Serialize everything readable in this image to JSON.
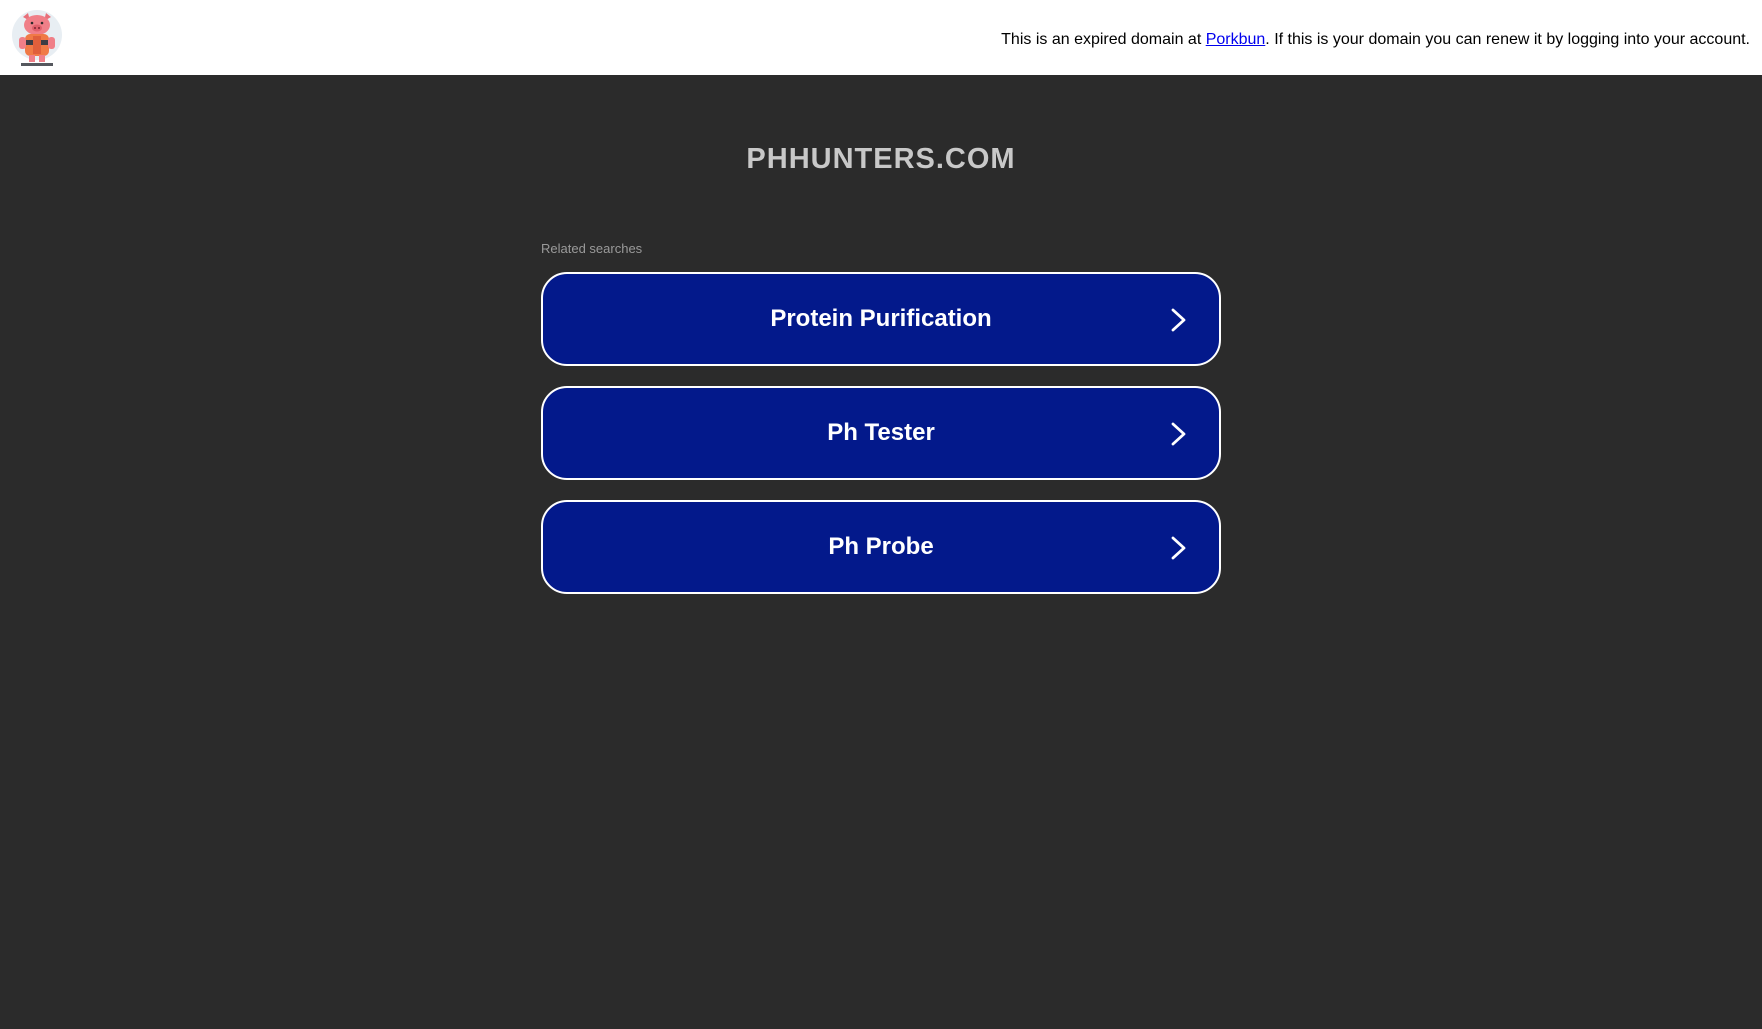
{
  "header": {
    "logo_icon": "porkbun-pig-logo-icon",
    "notice_prefix": "This is an expired domain at ",
    "notice_link": "Porkbun",
    "notice_suffix": ". If this is your domain you can renew it by logging into your account."
  },
  "main": {
    "domain_title": "PHHUNTERS.COM",
    "related_label": "Related searches",
    "searches": [
      {
        "label": "Protein Purification",
        "icon": "chevron-right-icon"
      },
      {
        "label": "Ph Tester",
        "icon": "chevron-right-icon"
      },
      {
        "label": "Ph Probe",
        "icon": "chevron-right-icon"
      }
    ]
  },
  "colors": {
    "page_background": "#2b2b2b",
    "button_background": "#03198b",
    "button_border": "#ffffff",
    "title_text": "#c8c8c8",
    "link": "#0000ee"
  }
}
